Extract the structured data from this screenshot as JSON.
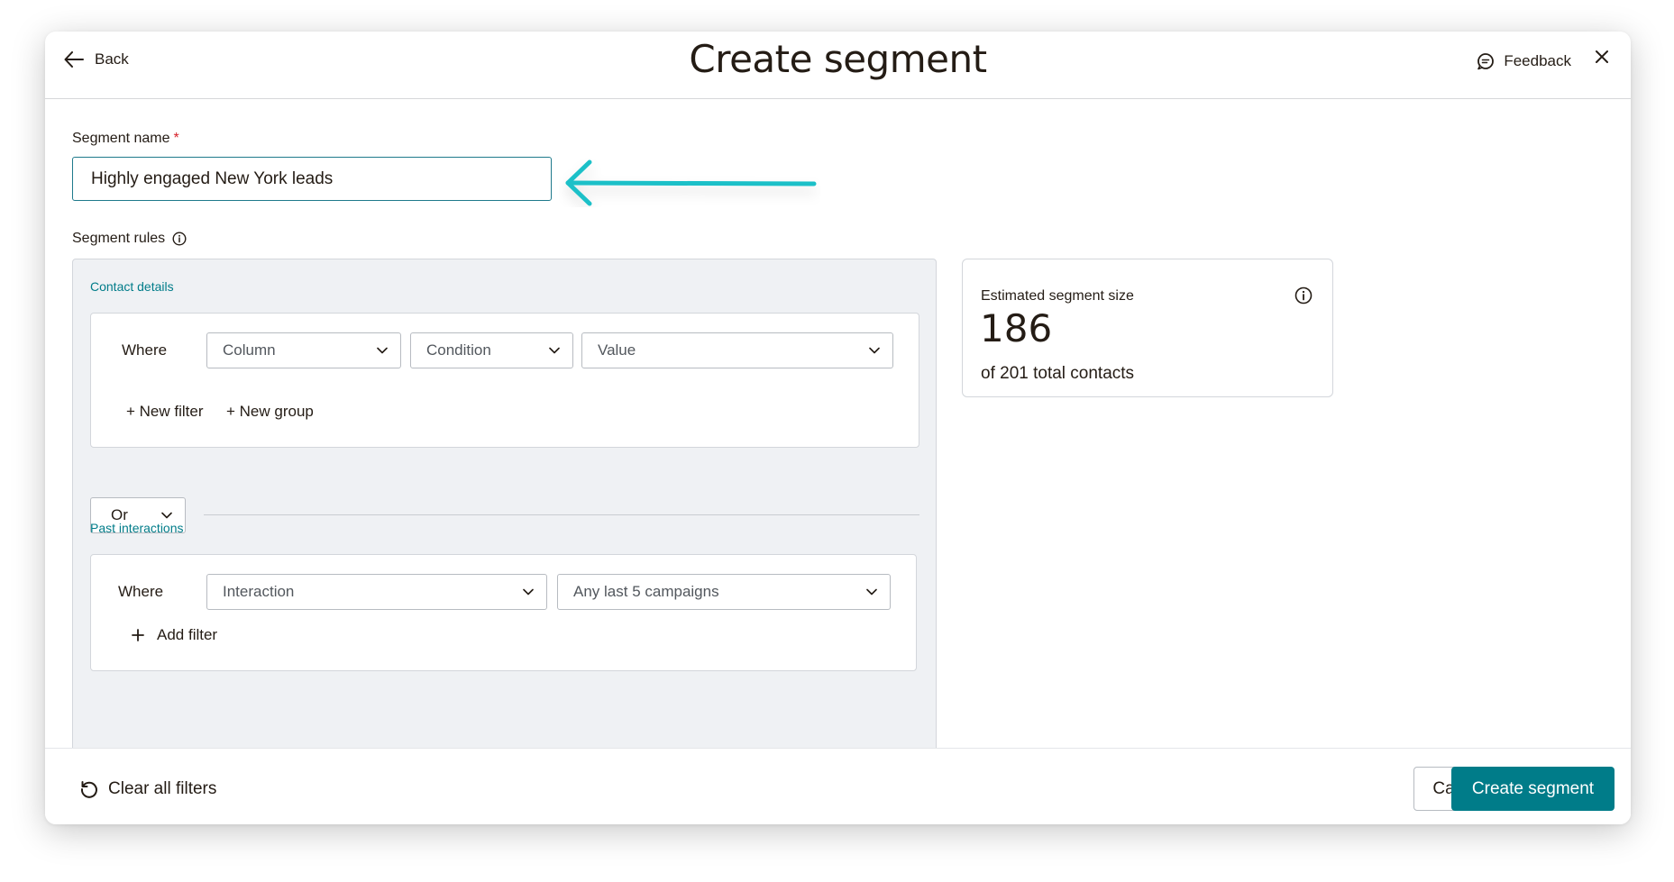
{
  "header": {
    "back_label": "Back",
    "title": "Create segment",
    "feedback_label": "Feedback"
  },
  "segment_name": {
    "label": "Segment name",
    "required_mark": "*",
    "value": "Highly engaged New York leads"
  },
  "segment_rules": {
    "label": "Segment rules",
    "contact_details": {
      "heading": "Contact details",
      "where_label": "Where",
      "column": "Column",
      "condition": "Condition",
      "value": "Value",
      "new_filter": "+ New filter",
      "new_group": "+ New group"
    },
    "operator": "Or",
    "past_interactions": {
      "heading": "Past interactions",
      "where_label": "Where",
      "interaction": "Interaction",
      "campaigns": "Any last 5 campaigns",
      "add_filter": "Add filter"
    }
  },
  "estimate": {
    "label": "Estimated segment size",
    "count": "186",
    "total": "of 201 total contacts"
  },
  "footer": {
    "clear_label": "Clear all filters",
    "cancel_label": "Cancel",
    "create_label": "Create segment"
  },
  "colors": {
    "accent": "#007c89",
    "arrow": "#1cc0c8",
    "input_border": "#1f7a8c"
  },
  "icons": [
    "arrow-left-icon",
    "chat-bubble-icon",
    "close-icon",
    "info-icon",
    "chevron-down-icon",
    "plus-icon",
    "refresh-icon",
    "annotation-arrow-icon"
  ]
}
